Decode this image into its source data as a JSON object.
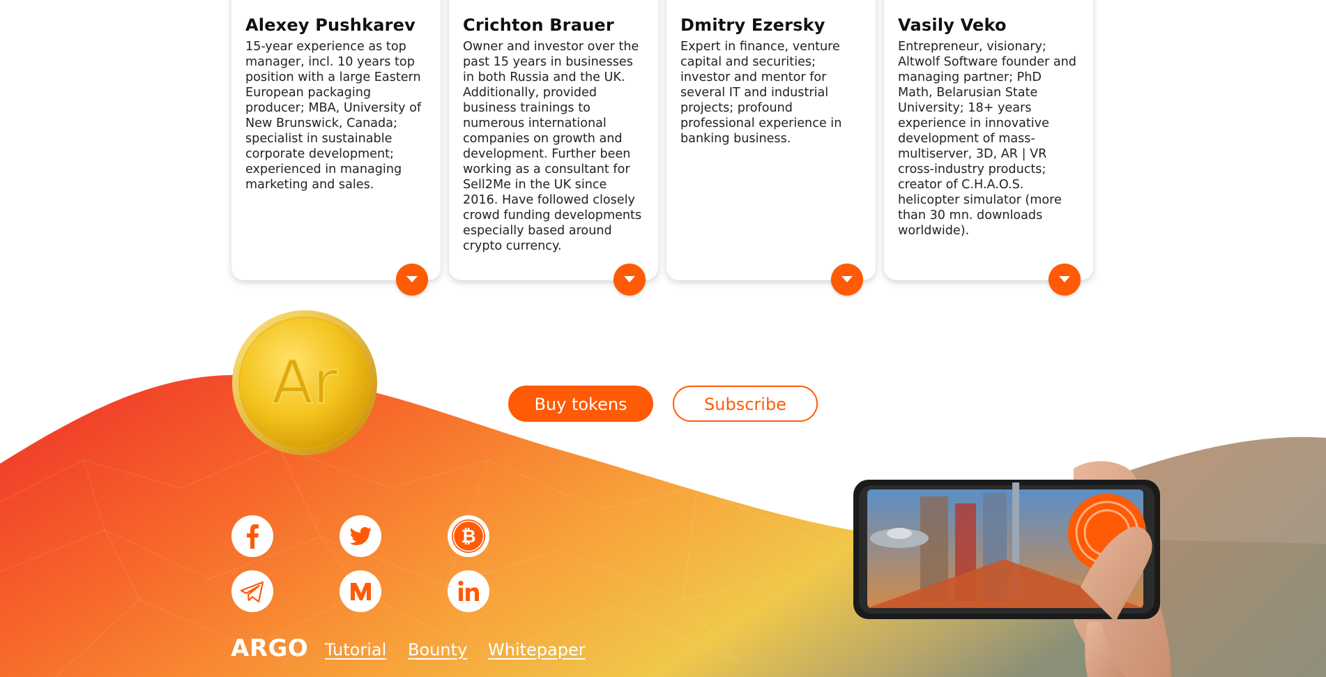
{
  "team": [
    {
      "name": "Alexey Pushkarev",
      "bio": "15-year experience as top manager, incl. 10 years top position with a large Eastern European packaging producer; MBA, University of New Brunswick, Canada; specialist in sustainable corporate development; experienced in managing marketing and sales."
    },
    {
      "name": "Crichton Brauer",
      "bio": "Owner and investor over the past 15 years in businesses in both Russia and the UK. Additionally, provided business trainings to numerous international companies on growth and development. Further been working as a consultant for Sell2Me in the UK since 2016. Have followed closely crowd funding developments especially based around crypto currency."
    },
    {
      "name": "Dmitry Ezersky",
      "bio": "Expert in finance, venture capital and securities; investor and mentor for several IT and industrial projects; profound professional experience in banking business."
    },
    {
      "name": "Vasily Veko",
      "bio": "Entrepreneur, visionary; Altwolf Software founder and managing partner; PhD Math, Belarusian State University; 18+ years experience in innovative development of mass-multiserver, 3D, AR | VR cross-industry products; creator of C.H.A.O.S. helicopter simulator (more than 30 mn. downloads worldwide)."
    }
  ],
  "coin": {
    "logo_text": "Ar"
  },
  "cta": {
    "buy_label": "Buy tokens",
    "subscribe_label": "Subscribe"
  },
  "social": [
    {
      "name": "facebook-icon"
    },
    {
      "name": "twitter-icon"
    },
    {
      "name": "bitcoin-icon"
    },
    {
      "name": "telegram-icon"
    },
    {
      "name": "medium-icon"
    },
    {
      "name": "linkedin-icon"
    }
  ],
  "footer": {
    "brand": "ARGO",
    "links": [
      "Tutorial",
      "Bounty",
      "Whitepaper"
    ]
  },
  "colors": {
    "accent": "#ff5a06",
    "coin_gold": "#f2c21a"
  }
}
